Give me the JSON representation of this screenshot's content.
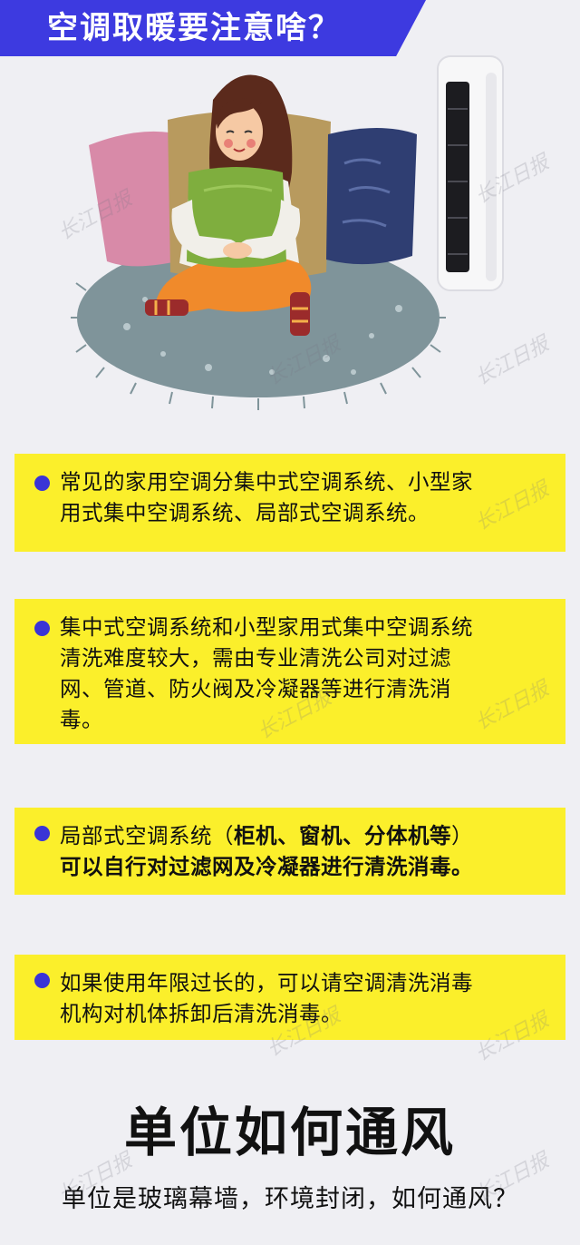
{
  "header": {
    "title": "空调取暖要注意啥？"
  },
  "cards": [
    {
      "lines": [
        "常见的家用空调分集中式空调系统、小型家",
        "用式集中空调系统、局部式空调系统。"
      ]
    },
    {
      "lines": [
        "集中式空调系统和小型家用式集中空调系统",
        "清洗难度较大，需由专业清洗公司对过滤",
        "网、管道、防火阀及冷凝器等进行清洗消",
        "毒。"
      ]
    },
    {
      "line1_plain": "局部式空调系统（",
      "line1_bold": "柜机、窗机、分体机等",
      "line1_end": "）",
      "line2_bold": "可以自行对过滤网及冷凝器进行清洗消毒。"
    },
    {
      "lines": [
        "如果使用年限过长的，可以请空调清洗消毒",
        "机构对机体拆卸后清洗消毒。"
      ]
    }
  ],
  "section": {
    "title": "单位如何通风",
    "subtitle": "单位是玻璃幕墙，环境封闭，如何通风？"
  },
  "watermark": "长江日报",
  "colors": {
    "background": "#efeff3",
    "banner": "#3d3ae0",
    "card": "#fbef2b",
    "bullet": "#3a34d6"
  },
  "icons": [
    "woman-with-pillows-illustration",
    "air-conditioner-icon",
    "bullet-dot-icon"
  ]
}
